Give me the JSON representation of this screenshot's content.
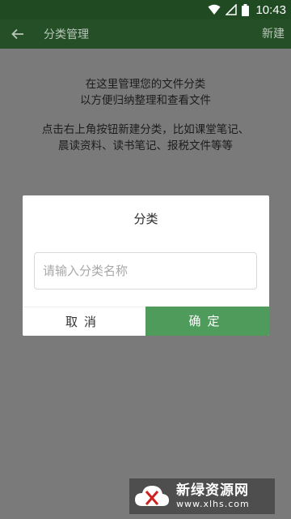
{
  "status_bar": {
    "time": "10:43",
    "icons": [
      "wifi-icon",
      "signal-icon",
      "battery-icon"
    ]
  },
  "app_bar": {
    "title": "分类管理",
    "new_label": "新建",
    "back_icon": "arrow-left-icon"
  },
  "hint": {
    "line1": "在这里管理您的文件分类",
    "line2": "以方便归纳整理和查看文件",
    "line3": "点击右上角按钮新建分类，比如课堂笔记、",
    "line4": "晨读资料、读书笔记、报税文件等等"
  },
  "dialog": {
    "title": "分类",
    "input_value": "",
    "input_placeholder": "请输入分类名称",
    "cancel_label": "取消",
    "ok_label": "确定"
  },
  "watermark": {
    "title": "新绿资源网",
    "url": "www.xlhs.com"
  },
  "colors": {
    "status_bar": "#1f4a22",
    "app_bar": "#254f27",
    "overlay": "#7a7a7a",
    "ok_button": "#4e9b5c"
  }
}
